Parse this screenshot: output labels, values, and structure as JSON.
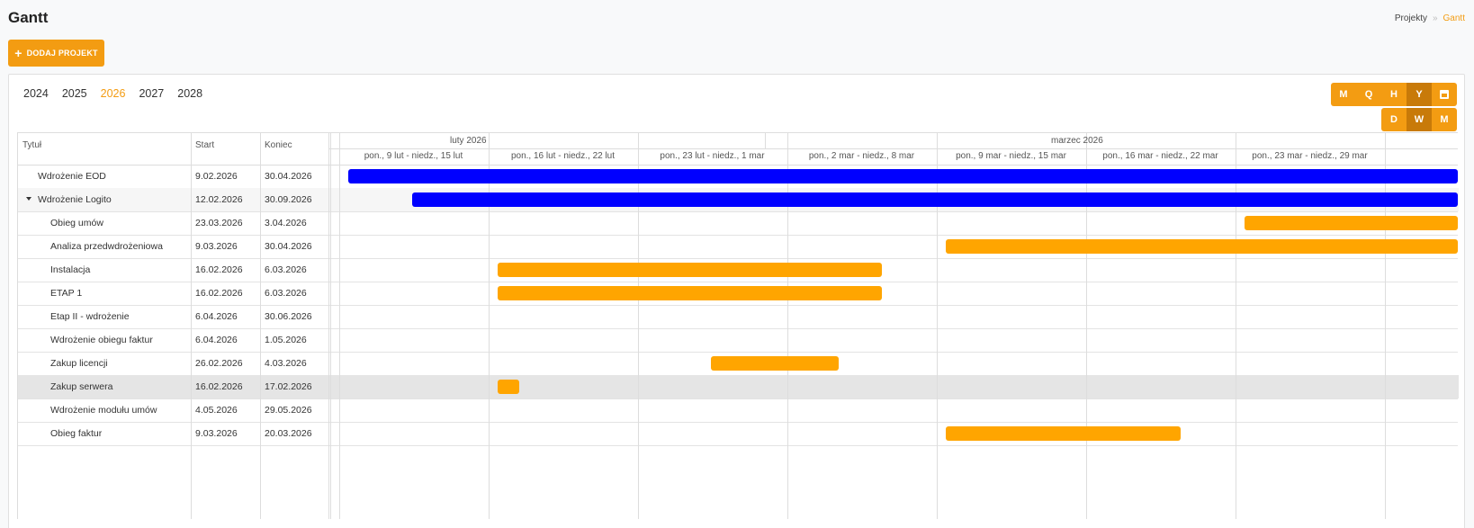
{
  "header": {
    "title": "Gantt"
  },
  "breadcrumb": {
    "parent": "Projekty",
    "separator": "»",
    "current": "Gantt"
  },
  "toolbar": {
    "add_project_label": "DODAJ PROJEKT"
  },
  "years": [
    "2024",
    "2025",
    "2026",
    "2027",
    "2028"
  ],
  "active_year": "2026",
  "view_buttons": [
    "M",
    "Q",
    "H",
    "Y"
  ],
  "active_view": "Y",
  "zoom_buttons": [
    "D",
    "W",
    "M"
  ],
  "active_zoom": "W",
  "table": {
    "col_title": "Tytuł",
    "col_start": "Start",
    "col_end": "Koniec"
  },
  "timeline": {
    "months": [
      "luty 2026",
      "marzec 2026"
    ],
    "weeks": [
      "pon., 9 lut - niedz., 15 lut",
      "pon., 16 lut - niedz., 22 lut",
      "pon., 23 lut - niedz., 1 mar",
      "pon., 2 mar - niedz., 8 mar",
      "pon., 9 mar - niedz., 15 mar",
      "pon., 16 mar - niedz., 22 mar",
      "pon., 23 mar - niedz., 29 mar"
    ]
  },
  "tasks": [
    {
      "title": "Wdrożenie EOD",
      "start": "9.02.2026",
      "end": "30.04.2026",
      "level": 0,
      "color": "#0000ff"
    },
    {
      "title": "Wdrożenie Logito",
      "start": "12.02.2026",
      "end": "30.09.2026",
      "level": 0,
      "expanded": true,
      "color": "#0000ff"
    },
    {
      "title": "Obieg umów",
      "start": "23.03.2026",
      "end": "3.04.2026",
      "level": 1,
      "color": "#ffa500"
    },
    {
      "title": "Analiza przedwdrożeniowa",
      "start": "9.03.2026",
      "end": "30.04.2026",
      "level": 1,
      "color": "#ffa500"
    },
    {
      "title": "Instalacja",
      "start": "16.02.2026",
      "end": "6.03.2026",
      "level": 1,
      "color": "#ffa500"
    },
    {
      "title": "ETAP 1",
      "start": "16.02.2026",
      "end": "6.03.2026",
      "level": 1,
      "color": "#ffa500"
    },
    {
      "title": "Etap II - wdrożenie",
      "start": "6.04.2026",
      "end": "30.06.2026",
      "level": 1,
      "color": "#ffa500"
    },
    {
      "title": "Wdrożenie obiegu faktur",
      "start": "6.04.2026",
      "end": "1.05.2026",
      "level": 1,
      "color": "#ffa500"
    },
    {
      "title": "Zakup licencji",
      "start": "26.02.2026",
      "end": "4.03.2026",
      "level": 1,
      "color": "#ffa500"
    },
    {
      "title": "Zakup serwera",
      "start": "16.02.2026",
      "end": "17.02.2026",
      "level": 1,
      "color": "#ffa500",
      "selected": true
    },
    {
      "title": "Wdrożenie modułu umów",
      "start": "4.05.2026",
      "end": "29.05.2026",
      "level": 1,
      "color": "#ffa500"
    },
    {
      "title": "Obieg faktur",
      "start": "9.03.2026",
      "end": "20.03.2026",
      "level": 1,
      "color": "#ffa500"
    }
  ]
}
